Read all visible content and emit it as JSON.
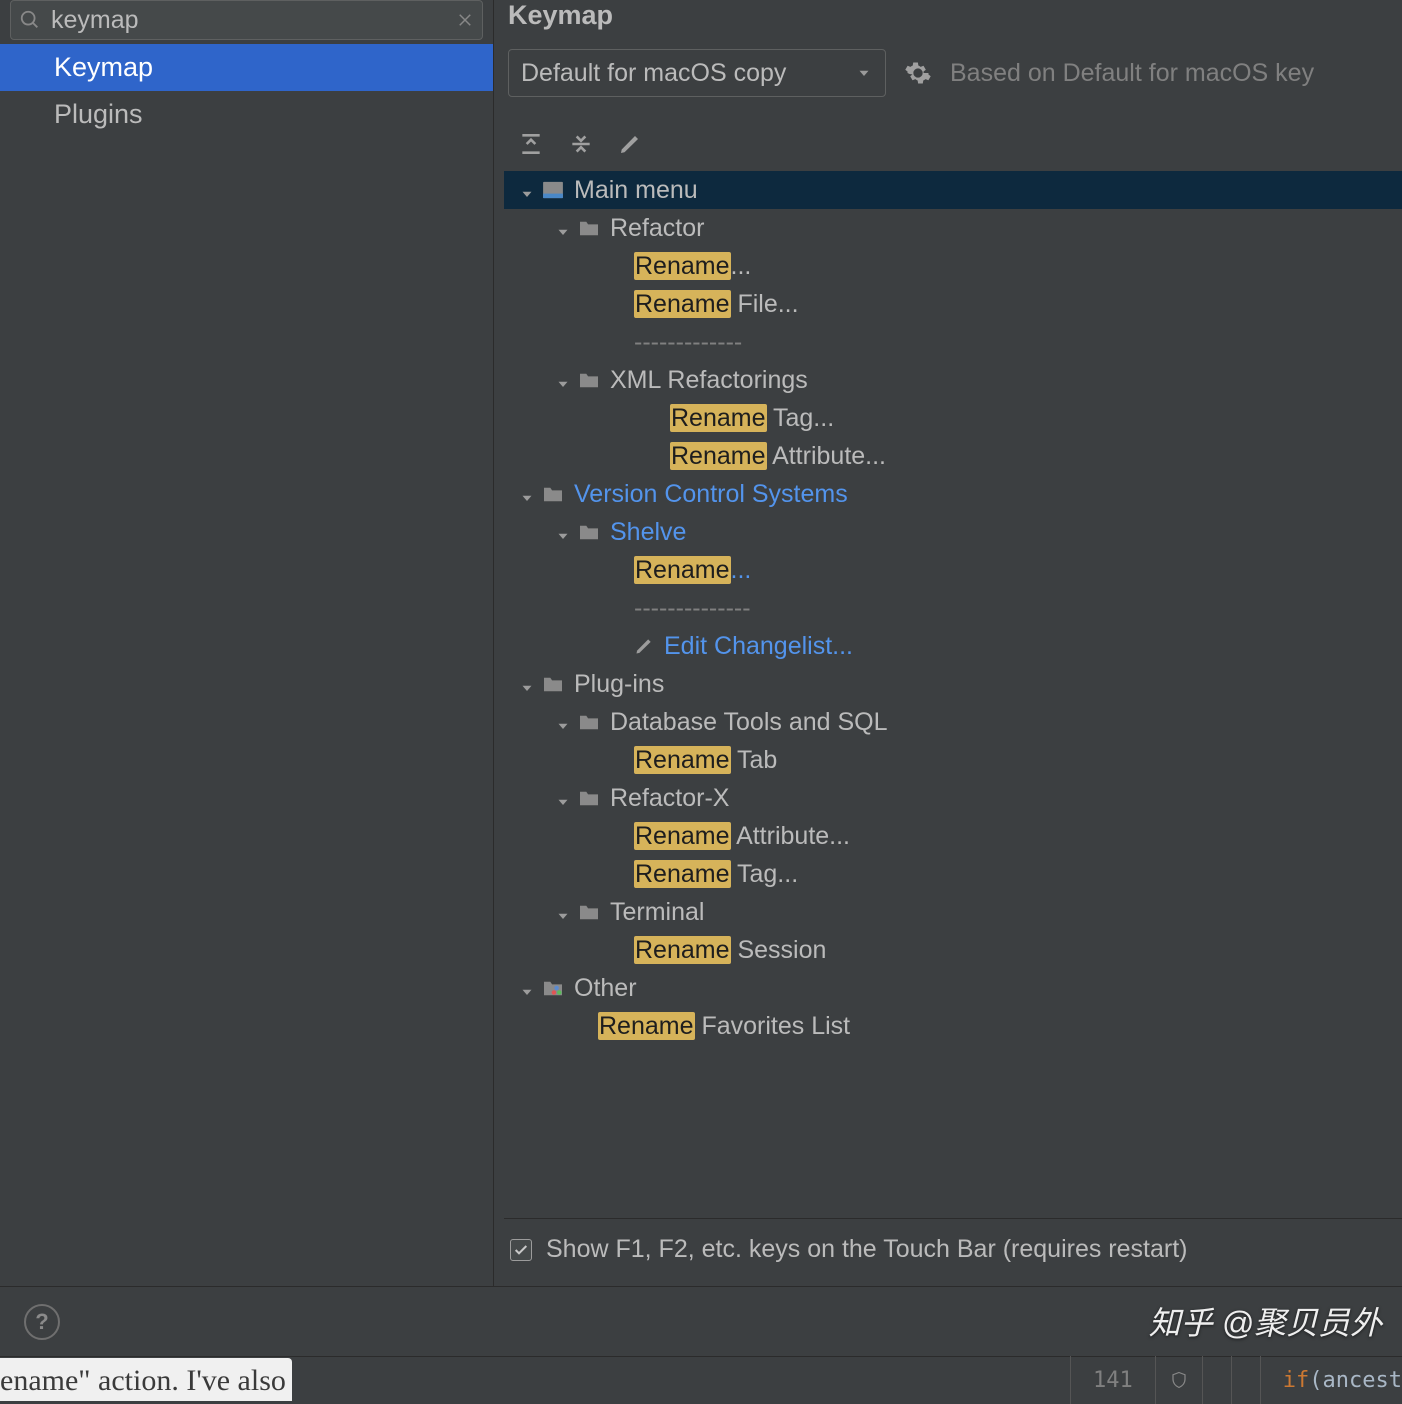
{
  "sidebar": {
    "search_value": "keymap",
    "items": [
      "Keymap",
      "Plugins"
    ],
    "selected_index": 0
  },
  "panel": {
    "title": "Keymap",
    "dropdown": "Default for macOS copy",
    "based_on": "Based on Default for macOS key"
  },
  "tree": {
    "highlight": "Rename",
    "nodes": [
      {
        "d": 0,
        "t": "menu",
        "label": "Main menu",
        "sel": true
      },
      {
        "d": 1,
        "t": "folder",
        "label": "Refactor"
      },
      {
        "d": 2,
        "t": "action",
        "hl": "Rename",
        "tail": "..."
      },
      {
        "d": 2,
        "t": "action",
        "hl": "Rename",
        "tail": " File..."
      },
      {
        "d": 2,
        "t": "sep"
      },
      {
        "d": 2,
        "t": "folder",
        "label": "XML Refactorings",
        "shift": true
      },
      {
        "d": 3,
        "t": "action",
        "hl": "Rename",
        "tail": " Tag..."
      },
      {
        "d": 3,
        "t": "action",
        "hl": "Rename",
        "tail": " Attribute..."
      },
      {
        "d": 0,
        "t": "folder",
        "label": "Version Control Systems",
        "link": true
      },
      {
        "d": 1,
        "t": "folder",
        "label": "Shelve",
        "link": true
      },
      {
        "d": 2,
        "t": "action",
        "hl": "Rename",
        "tail": "...",
        "link": true
      },
      {
        "d": 2,
        "t": "sep",
        "long": true
      },
      {
        "d": 2,
        "t": "pencil",
        "label": "Edit Changelist...",
        "link": true,
        "noarrow": true
      },
      {
        "d": 0,
        "t": "folder",
        "label": "Plug-ins"
      },
      {
        "d": 1,
        "t": "folder",
        "label": "Database Tools and SQL"
      },
      {
        "d": 2,
        "t": "action",
        "hl": "Rename",
        "tail": " Tab"
      },
      {
        "d": 1,
        "t": "folder",
        "label": "Refactor-X"
      },
      {
        "d": 2,
        "t": "action",
        "hl": "Rename",
        "tail": " Attribute..."
      },
      {
        "d": 2,
        "t": "action",
        "hl": "Rename",
        "tail": " Tag..."
      },
      {
        "d": 1,
        "t": "folder",
        "label": "Terminal"
      },
      {
        "d": 2,
        "t": "action",
        "hl": "Rename",
        "tail": " Session"
      },
      {
        "d": 0,
        "t": "other",
        "label": "Other"
      },
      {
        "d": 1,
        "t": "action",
        "hl": "Rename",
        "tail": " Favorites List",
        "noarrow": true,
        "shift2": true
      }
    ]
  },
  "checkbox_label": "Show F1, F2, etc. keys on the Touch Bar (requires restart)",
  "watermark": "知乎 @聚贝员外",
  "tooltip_fragment": "ename\" action. I've also",
  "status": {
    "line": "141",
    "if": "if",
    "paren": "(",
    "ident": "ancest"
  }
}
